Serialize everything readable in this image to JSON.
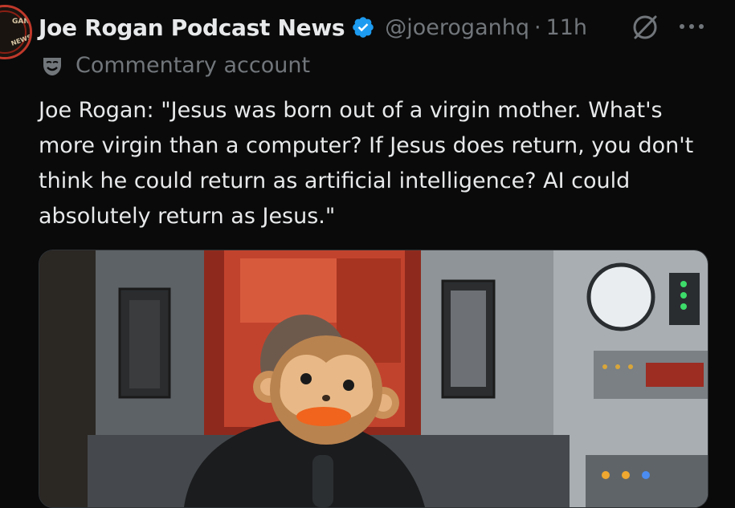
{
  "tweet": {
    "author": {
      "display_name": "Joe Rogan Podcast News",
      "handle": "@joeroganhq",
      "verified_icon": "verified-badge-icon",
      "avatar_text_top": "GAN",
      "avatar_text_side": "NEWS"
    },
    "separator": "·",
    "timestamp": "11h",
    "account_label": "Commentary account",
    "text": "Joe Rogan: \"Jesus was born out of a virgin mother. What's more virgin than a computer? If Jesus does return, you don't think he could return as artificial intelligence? AI could absolutely return as Jesus.\"",
    "actions": {
      "grok_icon": "grok-icon",
      "more_icon": "more-options-icon"
    },
    "media": {
      "type": "photo",
      "face_overlay": "monkey-face-emoji"
    }
  },
  "colors": {
    "background": "#0a0a0a",
    "text_primary": "#e7e9ea",
    "text_secondary": "#71767b",
    "verified_blue": "#1d9bf0",
    "avatar_ring": "#c0392b"
  }
}
